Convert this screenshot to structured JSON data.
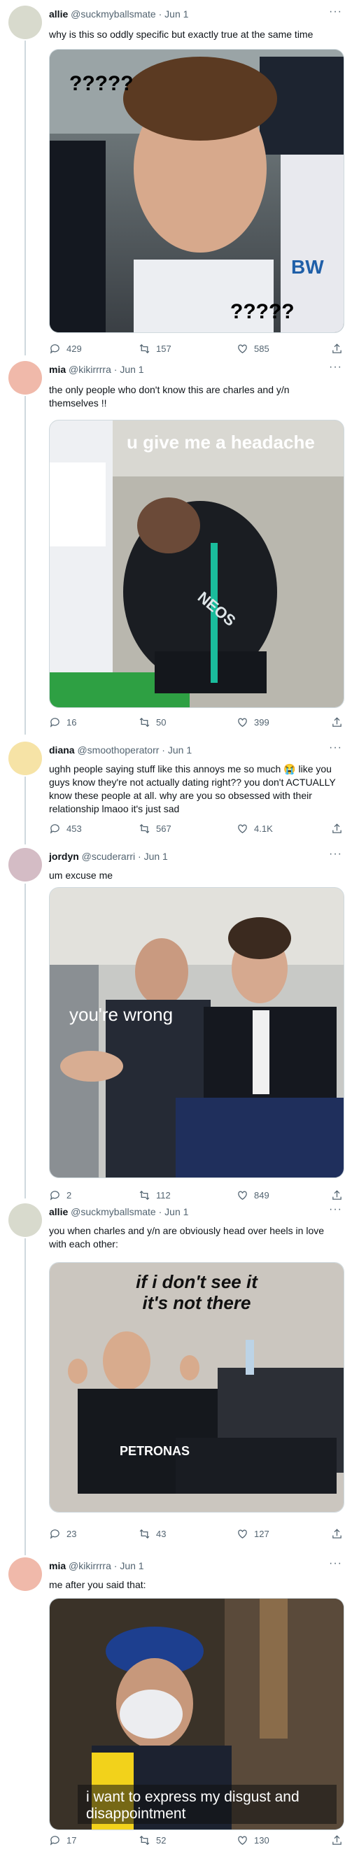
{
  "tweets": [
    {
      "name": "allie",
      "handle": "@suckmyballsmate",
      "dot": "·",
      "date": "Jun 1",
      "text": "why is this so oddly specific but exactly true at the same time",
      "media_captions": [
        "?????",
        "?????"
      ],
      "replies": "429",
      "retweets": "157",
      "likes": "585",
      "avatar_color": "#d8dacd"
    },
    {
      "name": "mia",
      "handle": "@kikirrrra",
      "dot": "·",
      "date": "Jun 1",
      "text": "the only people who don't know this are charles and y/n themselves !!",
      "media_captions": [
        "u give me a headache"
      ],
      "replies": "16",
      "retweets": "50",
      "likes": "399",
      "avatar_color": "#f0b9aa"
    },
    {
      "name": "diana",
      "handle": "@smoothoperatorr",
      "dot": "·",
      "date": "Jun 1",
      "text": "ughh people saying stuff like this annoys me so much 😭 like you guys know they're not actually dating right?? you don't ACTUALLY know these people at all. why are you so obsessed with their relationship lmaoo it's just sad",
      "replies": "453",
      "retweets": "567",
      "likes": "4.1K",
      "avatar_color": "#f6e3a6"
    },
    {
      "name": "jordyn",
      "handle": "@scuderarri",
      "dot": "·",
      "date": "Jun 1",
      "text": "um excuse me",
      "media_captions": [
        "you're wrong"
      ],
      "replies": "2",
      "retweets": "112",
      "likes": "849",
      "avatar_color": "#d4bcc5"
    },
    {
      "name": "allie",
      "handle": "@suckmyballsmate",
      "dot": "·",
      "date": "Jun 1",
      "text": "you when charles and y/n are obviously head over heels in love with each other:",
      "media_captions": [
        "if i don't see it",
        "it's not there"
      ],
      "replies": "23",
      "retweets": "43",
      "likes": "127",
      "avatar_color": "#d8dacd"
    },
    {
      "name": "mia",
      "handle": "@kikirrrra",
      "dot": "·",
      "date": "Jun 1",
      "text": "me after you said that:",
      "media_captions": [
        "i want to express my disgust and",
        "disappointment"
      ],
      "replies": "17",
      "retweets": "52",
      "likes": "130",
      "avatar_color": "#f0b9aa"
    }
  ],
  "more_glyph": "···",
  "icons": [
    "reply-icon",
    "retweet-icon",
    "like-icon",
    "share-icon"
  ],
  "colors": {
    "text": "#0f1419",
    "secondary": "#536471",
    "border": "#cfd9de",
    "background": "#ffffff"
  }
}
